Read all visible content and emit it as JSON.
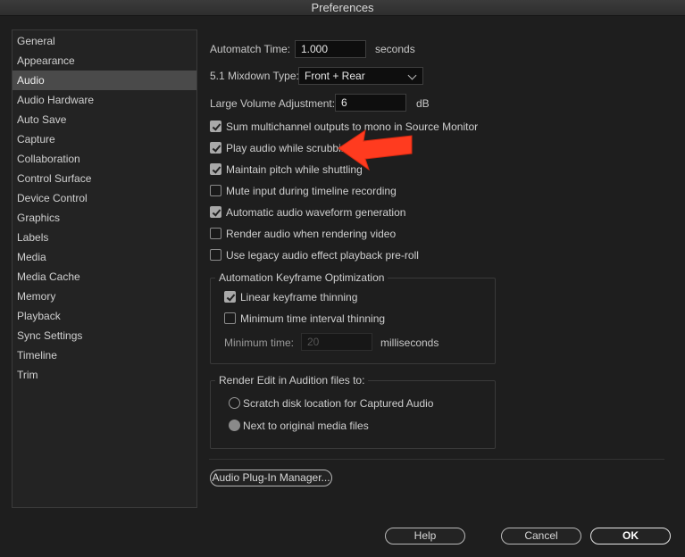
{
  "window": {
    "title": "Preferences"
  },
  "sidebar": {
    "items": [
      {
        "label": "General"
      },
      {
        "label": "Appearance"
      },
      {
        "label": "Audio"
      },
      {
        "label": "Audio Hardware"
      },
      {
        "label": "Auto Save"
      },
      {
        "label": "Capture"
      },
      {
        "label": "Collaboration"
      },
      {
        "label": "Control Surface"
      },
      {
        "label": "Device Control"
      },
      {
        "label": "Graphics"
      },
      {
        "label": "Labels"
      },
      {
        "label": "Media"
      },
      {
        "label": "Media Cache"
      },
      {
        "label": "Memory"
      },
      {
        "label": "Playback"
      },
      {
        "label": "Sync Settings"
      },
      {
        "label": "Timeline"
      },
      {
        "label": "Trim"
      }
    ],
    "selected": "Audio"
  },
  "audio": {
    "automatch_label": "Automatch Time:",
    "automatch_value": "1.000",
    "automatch_unit": "seconds",
    "mixdown_label": "5.1 Mixdown Type:",
    "mixdown_value": "Front + Rear",
    "large_volume_label": "Large Volume Adjustment:",
    "large_volume_value": "6",
    "large_volume_unit": "dB",
    "checkboxes": [
      {
        "label": "Sum multichannel outputs to mono in Source Monitor",
        "checked": true
      },
      {
        "label": "Play audio while scrubbing",
        "checked": true
      },
      {
        "label": "Maintain pitch while shuttling",
        "checked": true
      },
      {
        "label": "Mute input during timeline recording",
        "checked": false
      },
      {
        "label": "Automatic audio waveform generation",
        "checked": true
      },
      {
        "label": "Render audio when rendering video",
        "checked": false
      },
      {
        "label": "Use legacy audio effect playback pre-roll",
        "checked": false
      }
    ],
    "keyframe_group": {
      "title": "Automation Keyframe Optimization",
      "linear_label": "Linear keyframe thinning",
      "linear_checked": true,
      "min_interval_label": "Minimum time interval thinning",
      "min_interval_checked": false,
      "min_time_label": "Minimum time:",
      "min_time_value": "20",
      "min_time_unit": "milliseconds"
    },
    "render_group": {
      "title": "Render Edit in Audition files to:",
      "options": [
        {
          "label": "Scratch disk location for Captured Audio",
          "selected": false
        },
        {
          "label": "Next to original media files",
          "selected": true
        }
      ]
    },
    "plugin_manager_label": "Audio Plug-In Manager..."
  },
  "footer": {
    "help": "Help",
    "cancel": "Cancel",
    "ok": "OK"
  },
  "annotation": {
    "arrow_color": "#ff3b1f",
    "arrow_icon": "red-arrow-icon"
  }
}
